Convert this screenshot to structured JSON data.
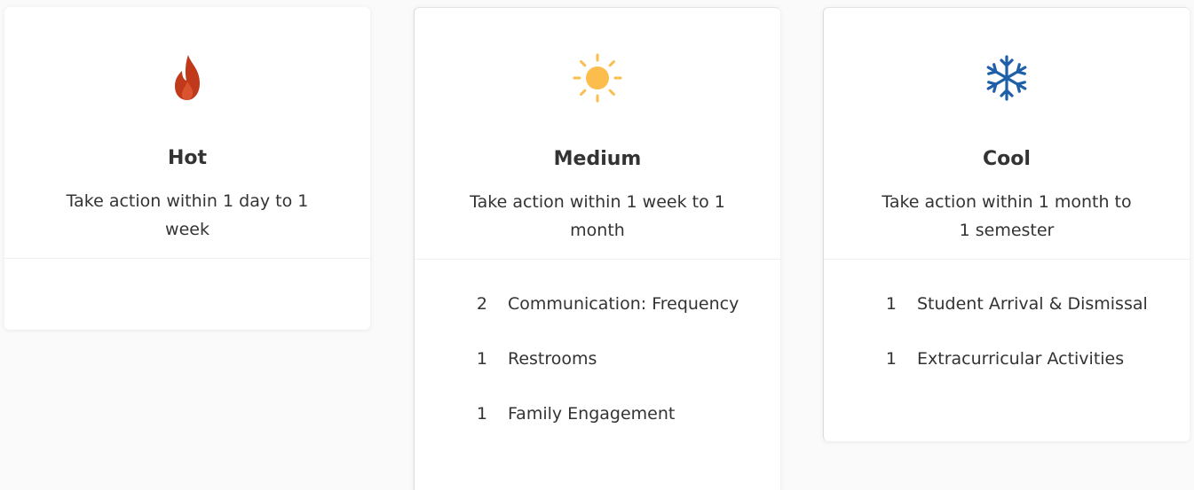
{
  "cards": [
    {
      "id": "hot",
      "icon": "flame-icon",
      "color": "#c0391b",
      "title": "Hot",
      "description": "Take action within 1 day to 1 week",
      "items": []
    },
    {
      "id": "medium",
      "icon": "sun-icon",
      "color": "#fbbd4b",
      "title": "Medium",
      "description": "Take action within 1 week to 1 month",
      "items": [
        {
          "count": "2",
          "label": "Communication: Frequency"
        },
        {
          "count": "1",
          "label": "Restrooms"
        },
        {
          "count": "1",
          "label": "Family Engagement"
        }
      ]
    },
    {
      "id": "cool",
      "icon": "snowflake-icon",
      "color": "#1f5fa8",
      "title": "Cool",
      "description": "Take action within 1 month to 1 semester",
      "items": [
        {
          "count": "1",
          "label": "Student Arrival & Dismissal"
        },
        {
          "count": "1",
          "label": "Extracurricular Activities"
        }
      ]
    }
  ]
}
